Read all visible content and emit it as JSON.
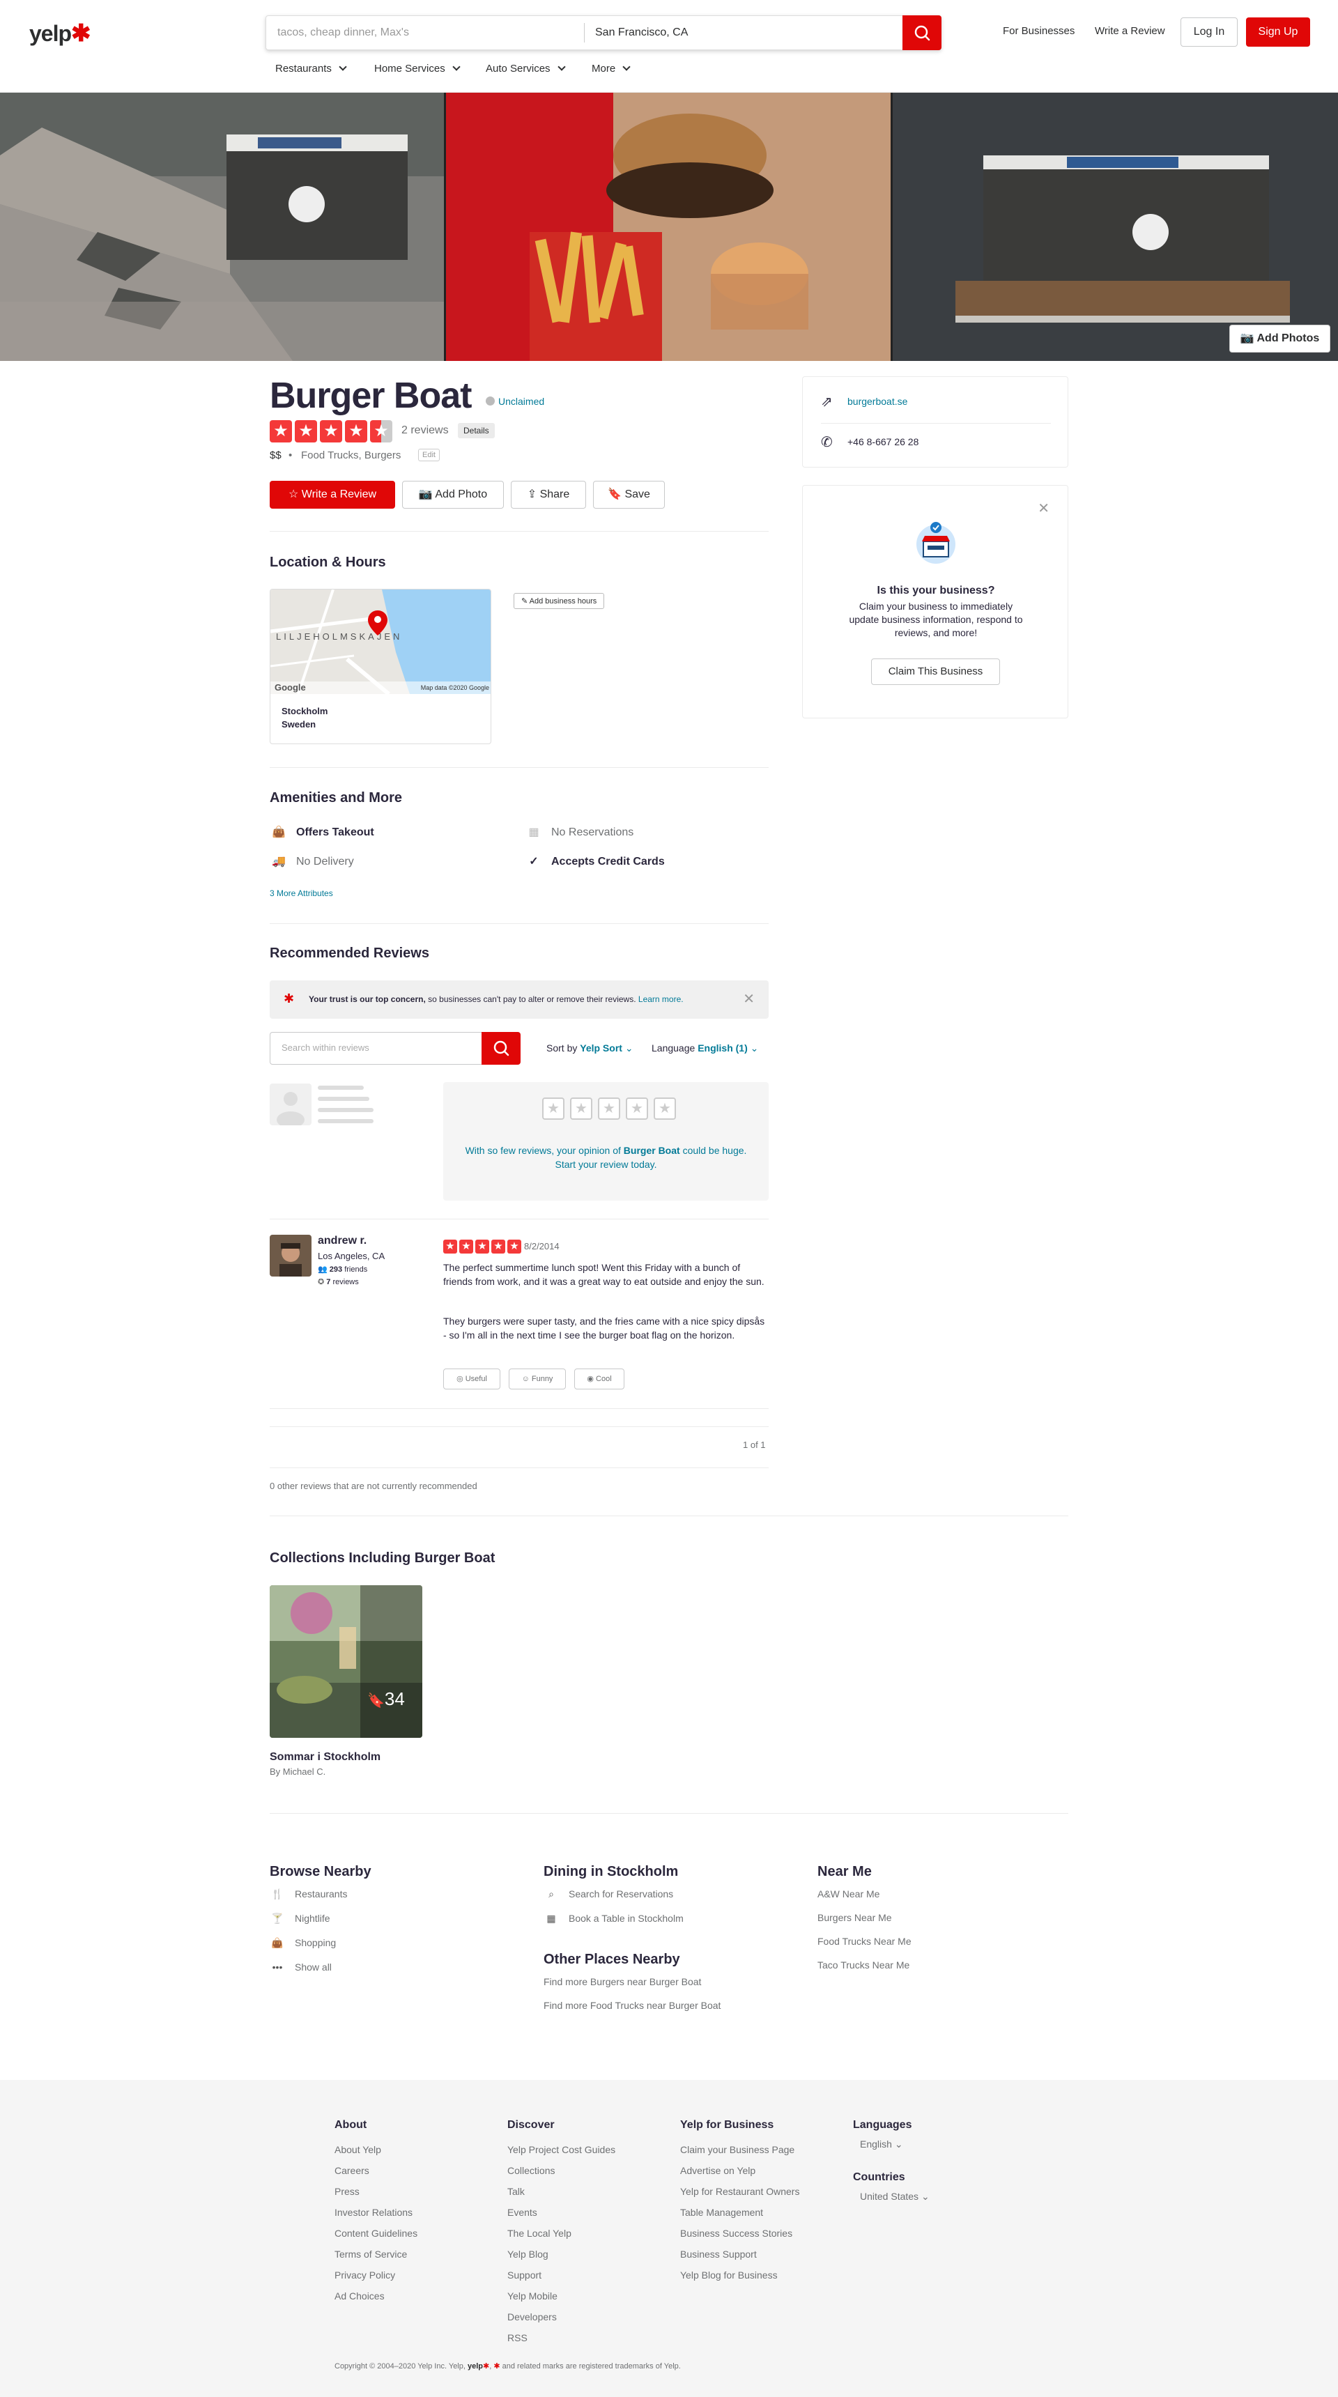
{
  "header": {
    "logo_text": "yelp",
    "logo_burst": "✱",
    "search_placeholder": "tacos, cheap dinner, Max's",
    "search_near": "San Francisco, CA",
    "for_businesses": "For Businesses",
    "write_review": "Write a Review",
    "login": "Log In",
    "signup": "Sign Up",
    "categories": [
      "Restaurants",
      "Home Services",
      "Auto Services",
      "More"
    ]
  },
  "photos": {
    "add_photos": "Add Photos"
  },
  "business": {
    "name": "Burger Boat",
    "claim_status": "Unclaimed",
    "rating": 4.5,
    "review_count": "2 reviews",
    "details": "Details",
    "price": "$$",
    "categories": "Food Trucks, Burgers",
    "edit": "Edit",
    "actions": {
      "write_review": "Write a Review",
      "add_photo": "Add Photo",
      "share": "Share",
      "save": "Save"
    }
  },
  "location": {
    "heading": "Location & Hours",
    "map_district": "LILJEHOLMSKAJEN",
    "map_credit": "Map data ©2020 Google",
    "map_logo": "Google",
    "city": "Stockholm",
    "country": "Sweden",
    "add_hours": "Add business hours"
  },
  "amenities": {
    "heading": "Amenities and More",
    "items": [
      {
        "label": "Offers Takeout",
        "icon": "bag-icon",
        "active": true
      },
      {
        "label": "No Reservations",
        "icon": "calendar-icon",
        "active": false
      },
      {
        "label": "No Delivery",
        "icon": "truck-icon",
        "active": false
      },
      {
        "label": "Accepts Credit Cards",
        "icon": "check-icon",
        "active": true
      }
    ],
    "more": "3 More Attributes"
  },
  "reviews": {
    "heading": "Recommended Reviews",
    "trust_bold": "Your trust is our top concern,",
    "trust_text": " so businesses can't pay to alter or remove their reviews.",
    "trust_link": "Learn more.",
    "search_placeholder": "Search within reviews",
    "sort_label": "Sort by",
    "sort_value": "Yelp Sort",
    "language_label": "Language",
    "language_value": "English (1)",
    "cta_pre": "With so few reviews, your opinion of ",
    "cta_name": "Burger Boat",
    "cta_post": " could be huge. Start your review today.",
    "list": [
      {
        "user": "andrew r.",
        "location": "Los Angeles, CA",
        "friends_count": "293",
        "friends_label": "friends",
        "reviews_count": "7",
        "reviews_label": "reviews",
        "rating": 5,
        "date": "8/2/2014",
        "text1": "The perfect summertime lunch spot! Went this Friday with a bunch of friends from work, and it was a great way to eat outside and enjoy the sun.",
        "text2": "They burgers were super tasty, and the fries came with a nice spicy dipsås - so I'm all in the next time I see the burger boat flag on the horizon.",
        "useful": "Useful",
        "funny": "Funny",
        "cool": "Cool"
      }
    ],
    "pagination": "1 of 1",
    "not_recommended": "0 other reviews that are not currently recommended"
  },
  "collections": {
    "heading": "Collections Including Burger Boat",
    "items": [
      {
        "title": "Sommar i Stockholm",
        "author": "By Michael C.",
        "count": "34"
      }
    ]
  },
  "sidebar": {
    "website": "burgerboat.se",
    "phone": "+46 8-667 26 28",
    "claim_title": "Is this your business?",
    "claim_text": "Claim your business to immediately update business information, respond to reviews, and more!",
    "claim_button": "Claim This Business"
  },
  "browse": {
    "nearby_heading": "Browse Nearby",
    "nearby": [
      {
        "label": "Restaurants",
        "icon": "utensils-icon"
      },
      {
        "label": "Nightlife",
        "icon": "cocktail-icon"
      },
      {
        "label": "Shopping",
        "icon": "shopping-bag-icon"
      },
      {
        "label": "Show all",
        "icon": "more-icon"
      }
    ],
    "dining_heading": "Dining in Stockholm",
    "dining": [
      {
        "label": "Search for Reservations",
        "icon": "search-icon"
      },
      {
        "label": "Book a Table in Stockholm",
        "icon": "calendar-icon"
      }
    ],
    "other_heading": "Other Places Nearby",
    "other": [
      "Find more Burgers near Burger Boat",
      "Find more Food Trucks near Burger Boat"
    ],
    "nearme_heading": "Near Me",
    "nearme": [
      "A&W Near Me",
      "Burgers Near Me",
      "Food Trucks Near Me",
      "Taco Trucks Near Me"
    ]
  },
  "footer": {
    "about_heading": "About",
    "about": [
      "About Yelp",
      "Careers",
      "Press",
      "Investor Relations",
      "Content Guidelines",
      "Terms of Service",
      "Privacy Policy",
      "Ad Choices"
    ],
    "discover_heading": "Discover",
    "discover": [
      "Yelp Project Cost Guides",
      "Collections",
      "Talk",
      "Events",
      "The Local Yelp",
      "Yelp Blog",
      "Support",
      "Yelp Mobile",
      "Developers",
      "RSS"
    ],
    "business_heading": "Yelp for Business",
    "business": [
      "Claim your Business Page",
      "Advertise on Yelp",
      "Yelp for Restaurant Owners",
      "Table Management",
      "Business Success Stories",
      "Business Support",
      "Yelp Blog for Business"
    ],
    "languages_heading": "Languages",
    "language": "English",
    "countries_heading": "Countries",
    "country": "United States",
    "copyright_pre": "Copyright © 2004–2020 Yelp Inc. Yelp,",
    "copyright_logo": "yelp",
    "copyright_post": "and related marks are registered trademarks of Yelp."
  },
  "colors": {
    "brand": "#e00707",
    "star": "#f43939",
    "link": "#027a97"
  }
}
